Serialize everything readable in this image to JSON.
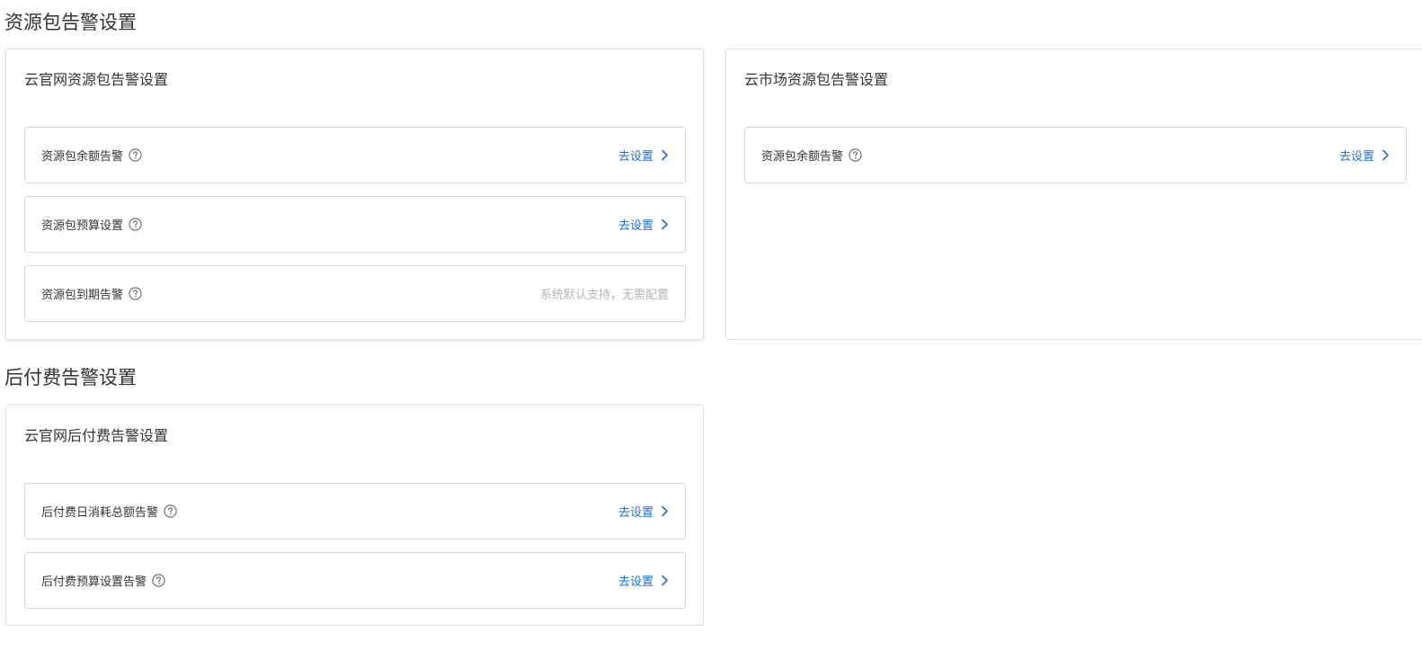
{
  "sections": [
    {
      "title": "资源包告警设置",
      "cards": [
        {
          "title": "云官网资源包告警设置",
          "rows": [
            {
              "label": "资源包余额告警",
              "action": "去设置"
            },
            {
              "label": "资源包预算设置",
              "action": "去设置"
            },
            {
              "label": "资源包到期告警",
              "note": "系统默认支持，无需配置"
            }
          ]
        },
        {
          "title": "云市场资源包告警设置",
          "rows": [
            {
              "label": "资源包余额告警",
              "action": "去设置"
            }
          ]
        }
      ]
    },
    {
      "title": "后付费告警设置",
      "cards": [
        {
          "title": "云官网后付费告警设置",
          "rows": [
            {
              "label": "后付费日消耗总额告警",
              "action": "去设置"
            },
            {
              "label": "后付费预算设置告警",
              "action": "去设置"
            }
          ]
        }
      ]
    }
  ],
  "icons": {
    "help": "question-circle-icon",
    "chevron": "chevron-right-icon"
  },
  "colors": {
    "link": "#1c6fd6",
    "muted_text": "#b5b5b5",
    "border": "#d9d9d9"
  }
}
